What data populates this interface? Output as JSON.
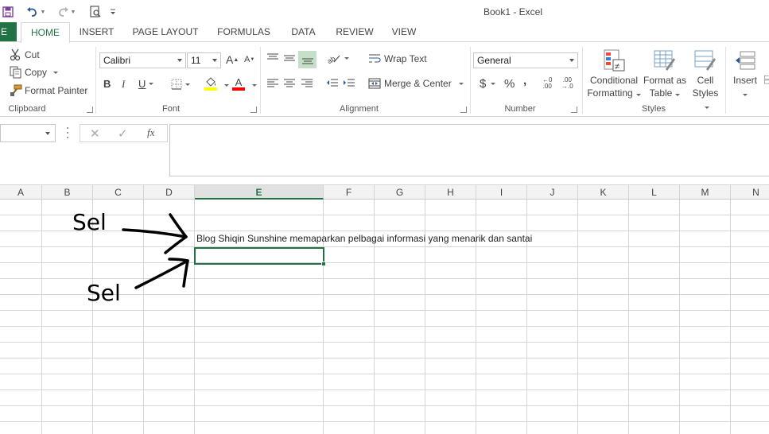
{
  "window": {
    "title": "Book1 - Excel"
  },
  "tabs": {
    "file": "E",
    "items": [
      "HOME",
      "INSERT",
      "PAGE LAYOUT",
      "FORMULAS",
      "DATA",
      "REVIEW",
      "VIEW"
    ],
    "active": "HOME"
  },
  "clipboard": {
    "cut": "Cut",
    "copy": "Copy",
    "format_painter": "Format Painter",
    "label": "Clipboard"
  },
  "font": {
    "name": "Calibri",
    "size": "11",
    "label": "Font",
    "fill_color": "#ffff00",
    "font_color": "#ff0000"
  },
  "alignment": {
    "wrap_text": "Wrap Text",
    "merge_center": "Merge & Center",
    "label": "Alignment"
  },
  "number": {
    "format": "General",
    "label": "Number"
  },
  "styles": {
    "conditional": [
      "Conditional",
      "Formatting"
    ],
    "format_table": [
      "Format as",
      "Table"
    ],
    "cell_styles": [
      "Cell",
      "Styles"
    ],
    "label": "Styles"
  },
  "cells_group": {
    "insert": "Insert"
  },
  "formula_bar": {
    "name_box": "",
    "fx": "fx",
    "content": ""
  },
  "columns": [
    "A",
    "B",
    "C",
    "D",
    "E",
    "F",
    "G",
    "H",
    "I",
    "J",
    "K",
    "L",
    "M",
    "N"
  ],
  "selected_column": "E",
  "cell_D3_text": "Blog Shiqin Sunshine memaparkan pelbagai informasi yang menarik dan santai",
  "annotations": {
    "label1": "Sel",
    "label2": "Sel"
  },
  "colors": {
    "accent": "#217346"
  }
}
